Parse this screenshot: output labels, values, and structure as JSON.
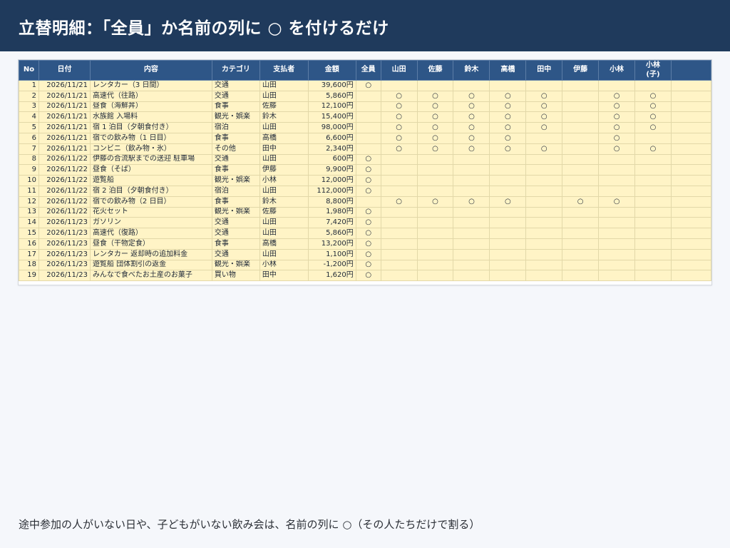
{
  "title": "立替明細：「全員」か名前の列に ○ を付けるだけ",
  "columns": [
    "No",
    "日付",
    "内容",
    "カテゴリ",
    "支払者",
    "金額",
    "全員",
    "山田",
    "佐藤",
    "鈴木",
    "高橋",
    "田中",
    "伊藤",
    "小林",
    "小林\n(子)",
    ""
  ],
  "rows": [
    {
      "no": "1",
      "date": "2026/11/21",
      "item": "レンタカー（3 日間）",
      "category": "交通",
      "payer": "山田",
      "amount": "39,600円",
      "marks": [
        "○",
        "",
        "",
        "",
        "",
        "",
        "",
        "",
        ""
      ]
    },
    {
      "no": "2",
      "date": "2026/11/21",
      "item": "高速代（往路）",
      "category": "交通",
      "payer": "山田",
      "amount": "5,860円",
      "marks": [
        "",
        "○",
        "○",
        "○",
        "○",
        "○",
        "",
        "○",
        "○"
      ]
    },
    {
      "no": "3",
      "date": "2026/11/21",
      "item": "昼食（海鮮丼）",
      "category": "食事",
      "payer": "佐藤",
      "amount": "12,100円",
      "marks": [
        "",
        "○",
        "○",
        "○",
        "○",
        "○",
        "",
        "○",
        "○"
      ]
    },
    {
      "no": "4",
      "date": "2026/11/21",
      "item": "水族館 入場料",
      "category": "観光・娯楽",
      "payer": "鈴木",
      "amount": "15,400円",
      "marks": [
        "",
        "○",
        "○",
        "○",
        "○",
        "○",
        "",
        "○",
        "○"
      ]
    },
    {
      "no": "5",
      "date": "2026/11/21",
      "item": "宿 1 泊目（夕朝食付き）",
      "category": "宿泊",
      "payer": "山田",
      "amount": "98,000円",
      "marks": [
        "",
        "○",
        "○",
        "○",
        "○",
        "○",
        "",
        "○",
        "○"
      ]
    },
    {
      "no": "6",
      "date": "2026/11/21",
      "item": "宿での飲み物（1 日目）",
      "category": "食事",
      "payer": "高橋",
      "amount": "6,600円",
      "marks": [
        "",
        "○",
        "○",
        "○",
        "○",
        "",
        "",
        "○",
        ""
      ]
    },
    {
      "no": "7",
      "date": "2026/11/21",
      "item": "コンビニ（飲み物・氷）",
      "category": "その他",
      "payer": "田中",
      "amount": "2,340円",
      "marks": [
        "",
        "○",
        "○",
        "○",
        "○",
        "○",
        "",
        "○",
        "○"
      ]
    },
    {
      "no": "8",
      "date": "2026/11/22",
      "item": "伊藤の合流駅までの送迎 駐車場",
      "category": "交通",
      "payer": "山田",
      "amount": "600円",
      "marks": [
        "○",
        "",
        "",
        "",
        "",
        "",
        "",
        "",
        ""
      ]
    },
    {
      "no": "9",
      "date": "2026/11/22",
      "item": "昼食（そば）",
      "category": "食事",
      "payer": "伊藤",
      "amount": "9,900円",
      "marks": [
        "○",
        "",
        "",
        "",
        "",
        "",
        "",
        "",
        ""
      ]
    },
    {
      "no": "10",
      "date": "2026/11/22",
      "item": "遊覧船",
      "category": "観光・娯楽",
      "payer": "小林",
      "amount": "12,000円",
      "marks": [
        "○",
        "",
        "",
        "",
        "",
        "",
        "",
        "",
        ""
      ]
    },
    {
      "no": "11",
      "date": "2026/11/22",
      "item": "宿 2 泊目（夕朝食付き）",
      "category": "宿泊",
      "payer": "山田",
      "amount": "112,000円",
      "marks": [
        "○",
        "",
        "",
        "",
        "",
        "",
        "",
        "",
        ""
      ]
    },
    {
      "no": "12",
      "date": "2026/11/22",
      "item": "宿での飲み物（2 日目）",
      "category": "食事",
      "payer": "鈴木",
      "amount": "8,800円",
      "marks": [
        "",
        "○",
        "○",
        "○",
        "○",
        "",
        "○",
        "○",
        ""
      ]
    },
    {
      "no": "13",
      "date": "2026/11/22",
      "item": "花火セット",
      "category": "観光・娯楽",
      "payer": "佐藤",
      "amount": "1,980円",
      "marks": [
        "○",
        "",
        "",
        "",
        "",
        "",
        "",
        "",
        ""
      ]
    },
    {
      "no": "14",
      "date": "2026/11/23",
      "item": "ガソリン",
      "category": "交通",
      "payer": "山田",
      "amount": "7,420円",
      "marks": [
        "○",
        "",
        "",
        "",
        "",
        "",
        "",
        "",
        ""
      ]
    },
    {
      "no": "15",
      "date": "2026/11/23",
      "item": "高速代（復路）",
      "category": "交通",
      "payer": "山田",
      "amount": "5,860円",
      "marks": [
        "○",
        "",
        "",
        "",
        "",
        "",
        "",
        "",
        ""
      ]
    },
    {
      "no": "16",
      "date": "2026/11/23",
      "item": "昼食（干物定食）",
      "category": "食事",
      "payer": "高橋",
      "amount": "13,200円",
      "marks": [
        "○",
        "",
        "",
        "",
        "",
        "",
        "",
        "",
        ""
      ]
    },
    {
      "no": "17",
      "date": "2026/11/23",
      "item": "レンタカー 返却時の追加料金",
      "category": "交通",
      "payer": "山田",
      "amount": "1,100円",
      "marks": [
        "○",
        "",
        "",
        "",
        "",
        "",
        "",
        "",
        ""
      ]
    },
    {
      "no": "18",
      "date": "2026/11/23",
      "item": "遊覧船 団体割引の返金",
      "category": "観光・娯楽",
      "payer": "小林",
      "amount": "-1,200円",
      "marks": [
        "○",
        "",
        "",
        "",
        "",
        "",
        "",
        "",
        ""
      ]
    },
    {
      "no": "19",
      "date": "2026/11/23",
      "item": "みんなで食べたお土産のお菓子",
      "category": "買い物",
      "payer": "田中",
      "amount": "1,620円",
      "marks": [
        "○",
        "",
        "",
        "",
        "",
        "",
        "",
        "",
        ""
      ]
    }
  ],
  "footer_note": "途中参加の人がいない日や、子どもがいない飲み会は、名前の列に ○（その人たちだけで割る）",
  "colors": {
    "header_bg": "#1f3a5c",
    "table_header_bg": "#2e5687",
    "input_cell_bg": "#fff4c6"
  }
}
